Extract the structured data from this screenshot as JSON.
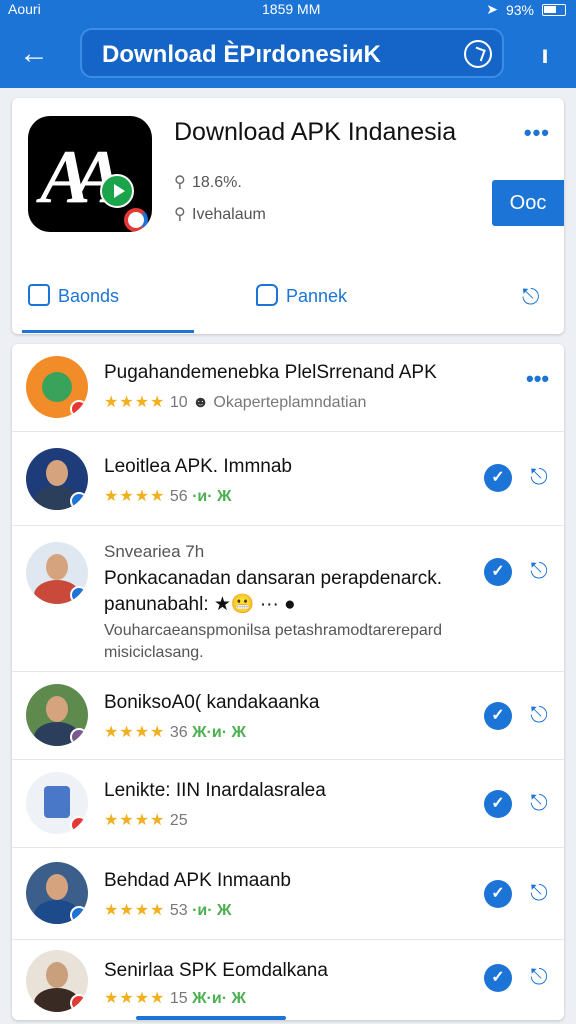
{
  "status_bar": {
    "carrier": "Aouri",
    "time": "1859 MM",
    "battery": "93%"
  },
  "header": {
    "title": "Download ЀPırdonesiиK"
  },
  "app": {
    "title": "Download APK Indanesia",
    "rating": "18.6%.",
    "category": "Ivehalaum",
    "open_label": "Ooc",
    "tabs": [
      "Baonds",
      "Pannek"
    ]
  },
  "list": [
    {
      "title": "Pugahandemenebka PlelSrrenand APK",
      "rating_text": "10",
      "subtitle": "Okaperteplamndatian",
      "type": "featured"
    },
    {
      "title": "Leoitlea APK. Immnab",
      "rating_text": "56",
      "emojis": "·и· Ж",
      "type": "user"
    },
    {
      "title": "Snveariea 7h",
      "body": "Ponkacanadan dansaran perapdenarck. panunabahl: ★😬 ··· ●",
      "desc": "Vouharcaeanspmonilsa petashramodtarerepard misiciclasang.",
      "type": "post"
    },
    {
      "title": "BoniksoA0( kandakaanka",
      "rating_text": "36",
      "emojis": "Ж·и· Ж",
      "type": "user"
    },
    {
      "title": "Lenikte: IIN Inardalasralea",
      "rating_text": "25",
      "type": "user"
    },
    {
      "title": "Behdad  APK Inmaanb",
      "rating_text": "53",
      "emojis": "·и· Ж",
      "type": "user"
    },
    {
      "title": "Senirlaa SPK Eomdalkana",
      "rating_text": "15",
      "emojis": "Ж·и· Ж",
      "type": "user"
    }
  ]
}
